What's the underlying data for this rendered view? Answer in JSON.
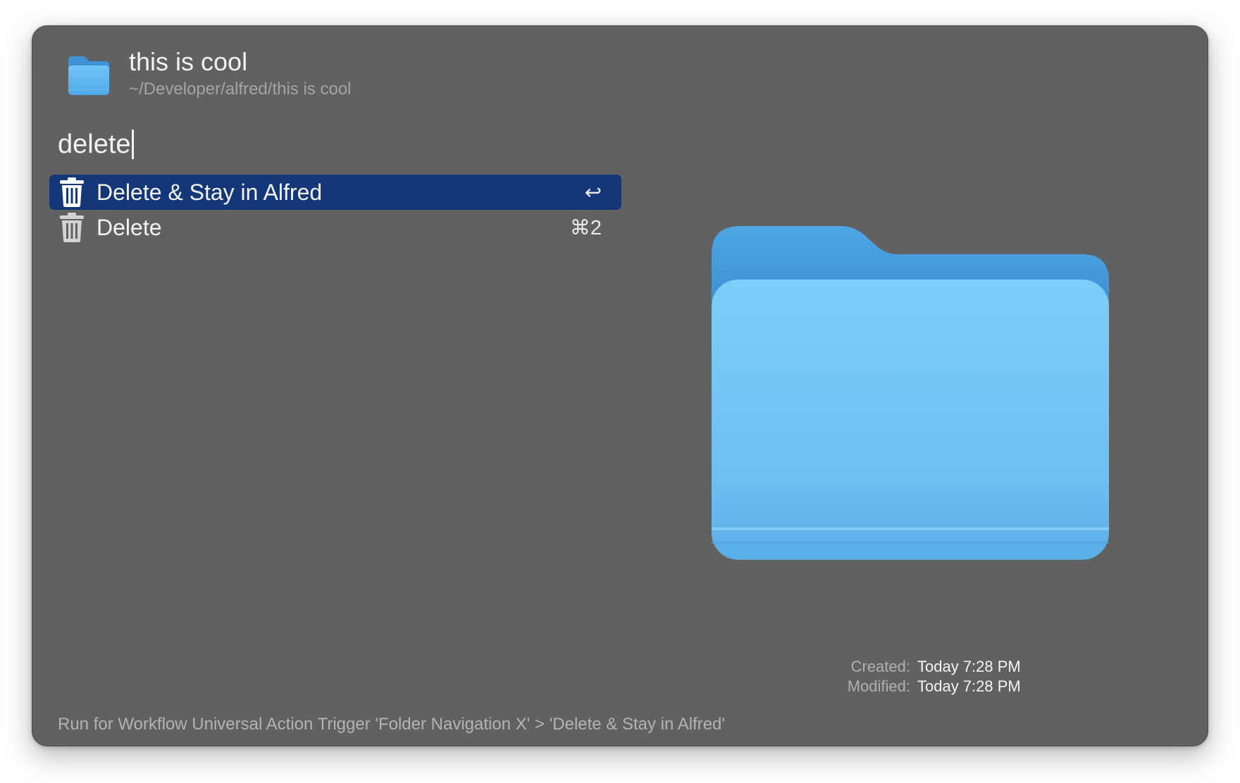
{
  "colors": {
    "window_bg": "#616161",
    "selection": "#14377a",
    "folder_blue": "#5fb8ef"
  },
  "header": {
    "icon": "folder-icon",
    "title": "this is cool",
    "path": "~/Developer/alfred/this is cool"
  },
  "search": {
    "query": "delete"
  },
  "results": [
    {
      "icon": "trash-icon",
      "label": "Delete & Stay in Alfred",
      "shortcut": "↩",
      "selected": true
    },
    {
      "icon": "trash-icon",
      "label": "Delete",
      "shortcut": "⌘2",
      "selected": false
    }
  ],
  "preview": {
    "icon": "folder-icon",
    "created_label": "Created:",
    "created_value": "Today 7:28 PM",
    "modified_label": "Modified:",
    "modified_value": "Today 7:28 PM"
  },
  "footer": {
    "text": "Run for Workflow Universal Action Trigger 'Folder Navigation X' > 'Delete & Stay in Alfred'"
  }
}
